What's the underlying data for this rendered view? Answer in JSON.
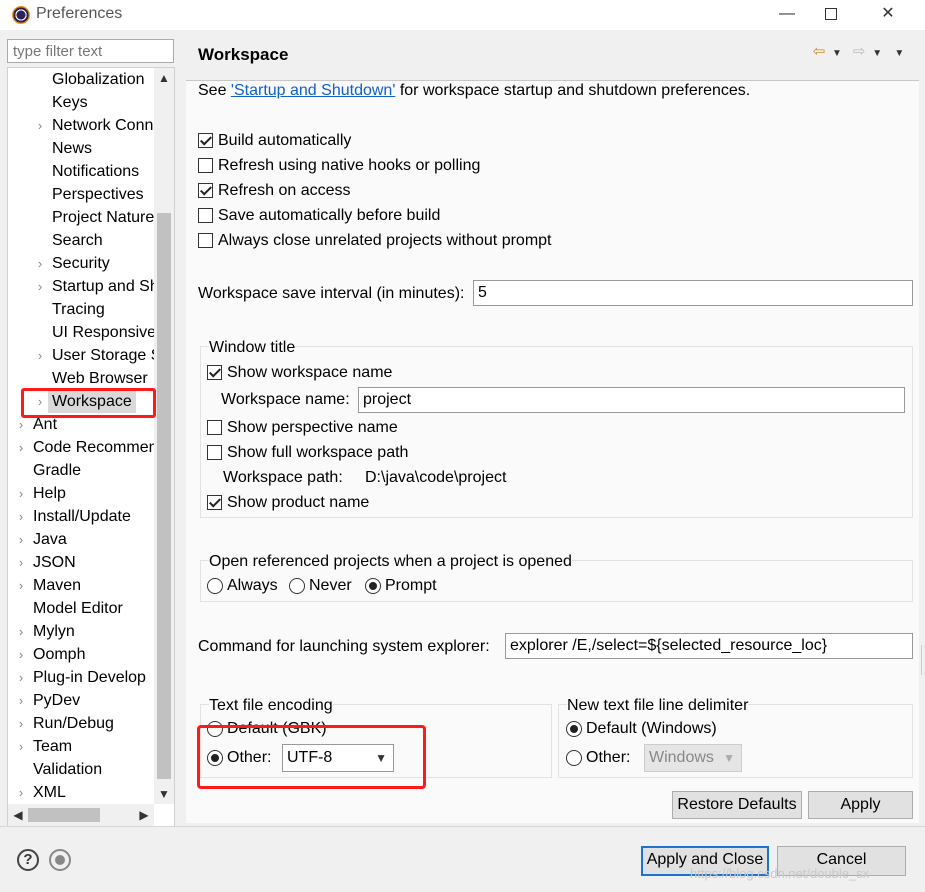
{
  "window": {
    "title": "Preferences",
    "minimize_glyph": "—",
    "close_glyph": "✕"
  },
  "sidebar": {
    "filter_placeholder": "type filter text",
    "items": [
      {
        "label": "Globalization",
        "expandable": false,
        "level": 1
      },
      {
        "label": "Keys",
        "expandable": false,
        "level": 1
      },
      {
        "label": "Network Conn",
        "expandable": true,
        "level": 1
      },
      {
        "label": "News",
        "expandable": false,
        "level": 1
      },
      {
        "label": "Notifications",
        "expandable": false,
        "level": 1
      },
      {
        "label": "Perspectives",
        "expandable": false,
        "level": 1
      },
      {
        "label": "Project Nature",
        "expandable": false,
        "level": 1
      },
      {
        "label": "Search",
        "expandable": false,
        "level": 1
      },
      {
        "label": "Security",
        "expandable": true,
        "level": 1
      },
      {
        "label": "Startup and Sh",
        "expandable": true,
        "level": 1
      },
      {
        "label": "Tracing",
        "expandable": false,
        "level": 1
      },
      {
        "label": "UI Responsive",
        "expandable": false,
        "level": 1
      },
      {
        "label": "User Storage S",
        "expandable": true,
        "level": 1
      },
      {
        "label": "Web Browser",
        "expandable": false,
        "level": 1
      },
      {
        "label": "Workspace",
        "expandable": true,
        "level": 1,
        "selected": true
      },
      {
        "label": "Ant",
        "expandable": true,
        "level": 0
      },
      {
        "label": "Code Recommen",
        "expandable": true,
        "level": 0
      },
      {
        "label": "Gradle",
        "expandable": false,
        "level": 0
      },
      {
        "label": "Help",
        "expandable": true,
        "level": 0
      },
      {
        "label": "Install/Update",
        "expandable": true,
        "level": 0
      },
      {
        "label": "Java",
        "expandable": true,
        "level": 0
      },
      {
        "label": "JSON",
        "expandable": true,
        "level": 0
      },
      {
        "label": "Maven",
        "expandable": true,
        "level": 0
      },
      {
        "label": "Model Editor",
        "expandable": false,
        "level": 0
      },
      {
        "label": "Mylyn",
        "expandable": true,
        "level": 0
      },
      {
        "label": "Oomph",
        "expandable": true,
        "level": 0
      },
      {
        "label": "Plug-in Develop",
        "expandable": true,
        "level": 0
      },
      {
        "label": "PyDev",
        "expandable": true,
        "level": 0
      },
      {
        "label": "Run/Debug",
        "expandable": true,
        "level": 0
      },
      {
        "label": "Team",
        "expandable": true,
        "level": 0
      },
      {
        "label": "Validation",
        "expandable": false,
        "level": 0
      },
      {
        "label": "XML",
        "expandable": true,
        "level": 0
      }
    ]
  },
  "page": {
    "title": "Workspace",
    "intro_prefix": "See ",
    "intro_link": "'Startup and Shutdown'",
    "intro_suffix": " for workspace startup and shutdown preferences.",
    "checkboxes": [
      {
        "label": "Build automatically",
        "checked": true
      },
      {
        "label": "Refresh using native hooks or polling",
        "checked": false
      },
      {
        "label": "Refresh on access",
        "checked": true
      },
      {
        "label": "Save automatically before build",
        "checked": false
      },
      {
        "label": "Always close unrelated projects without prompt",
        "checked": false
      }
    ],
    "save_interval_label": "Workspace save interval (in minutes):",
    "save_interval_value": "5",
    "window_title_group": {
      "label": "Window title",
      "show_workspace_name": "Show workspace name",
      "workspace_name_label": "Workspace name:",
      "workspace_name_value": "project",
      "show_perspective_name": "Show perspective name",
      "show_full_path": "Show full workspace path",
      "workspace_path_label": "Workspace path:",
      "workspace_path_value": "D:\\java\\code\\project",
      "show_product_name": "Show product name"
    },
    "open_referenced_group": {
      "label": "Open referenced projects when a project is opened",
      "options": [
        "Always",
        "Never",
        "Prompt"
      ],
      "selected": "Prompt"
    },
    "explorer_label": "Command for launching system explorer:",
    "explorer_value": "explorer /E,/select=${selected_resource_loc}",
    "encoding_group": {
      "label": "Text file encoding",
      "default_option": "Default (GBK)",
      "other_option": "Other:",
      "other_value": "UTF-8"
    },
    "delimiter_group": {
      "label": "New text file line delimiter",
      "default_option": "Default (Windows)",
      "other_option": "Other:",
      "other_value": "Windows"
    },
    "restore_defaults": "Restore Defaults",
    "apply": "Apply"
  },
  "footer": {
    "apply_and_close": "Apply and Close",
    "cancel": "Cancel",
    "help_glyph": "?",
    "watermark": "https://blog.csdn.net/double_sx"
  },
  "colors": {
    "highlight": "#ff1a1a",
    "link": "#1060c8",
    "default_button_border": "#1a73d0"
  }
}
